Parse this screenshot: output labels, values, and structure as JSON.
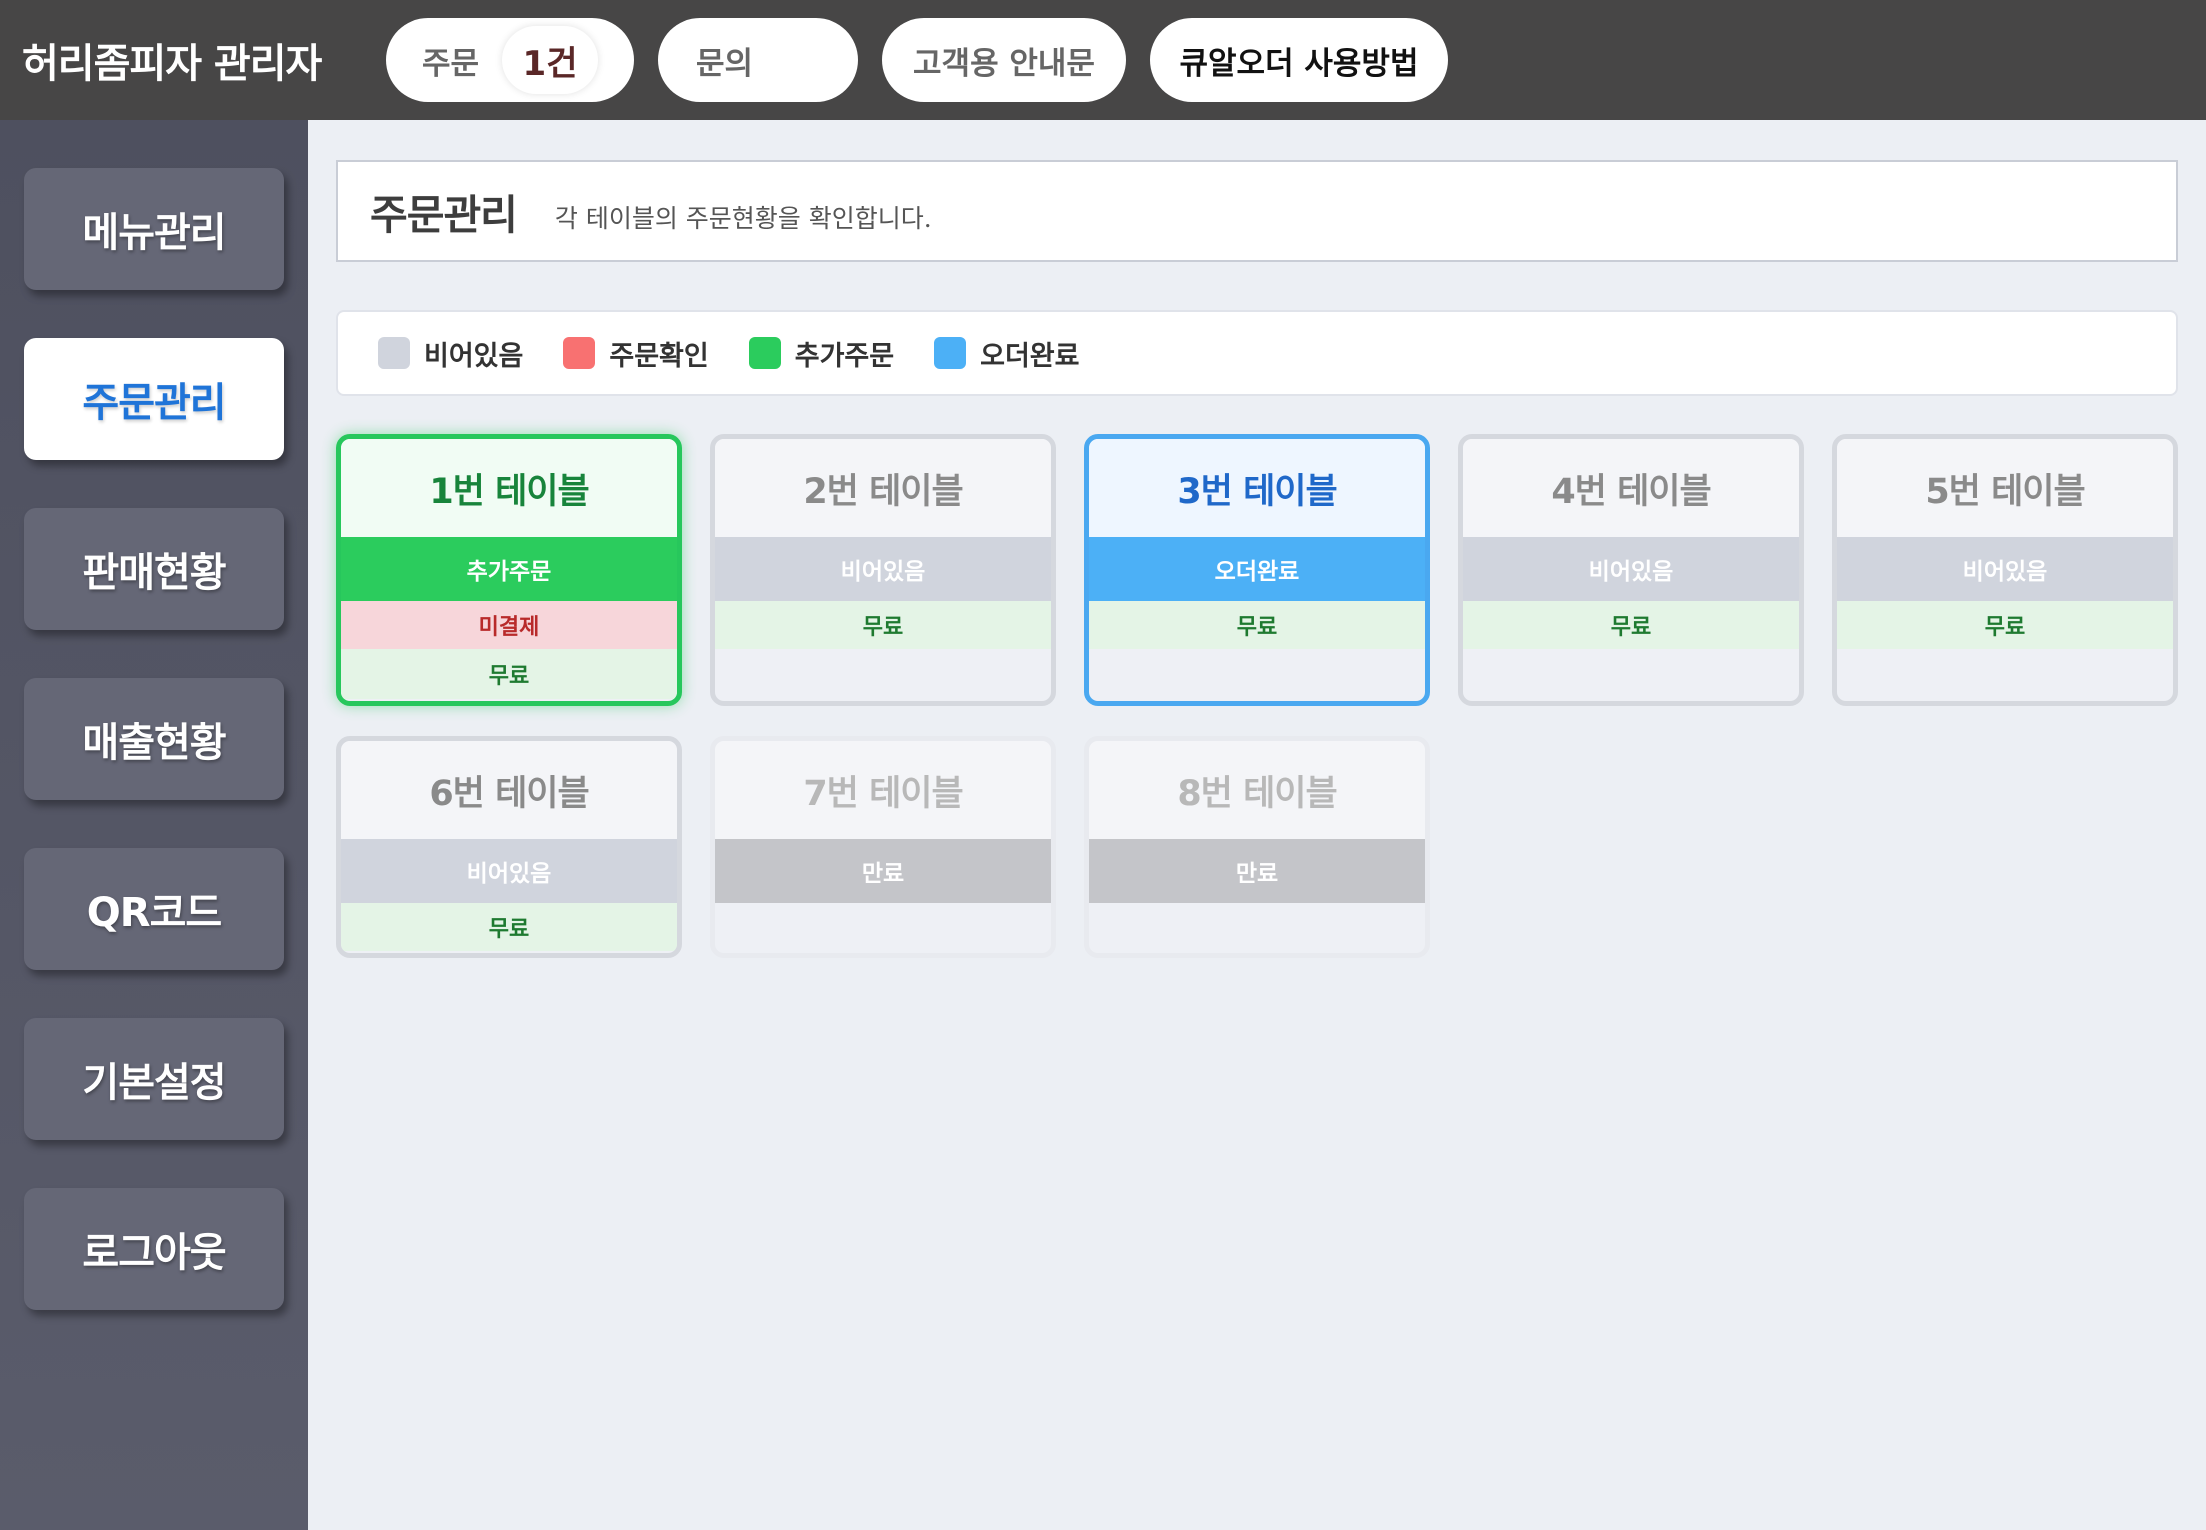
{
  "app_title": "허리좀피자 관리자",
  "topbar": {
    "orders_label": "주문",
    "orders_count": "1건",
    "inquiry_label": "문의",
    "guide_label": "고객용 안내문",
    "howto_label": "큐알오더 사용방법"
  },
  "sidebar": {
    "items": [
      {
        "label": "메뉴관리",
        "active": false
      },
      {
        "label": "주문관리",
        "active": true
      },
      {
        "label": "판매현황",
        "active": false
      },
      {
        "label": "매출현황",
        "active": false
      },
      {
        "label": "QR코드",
        "active": false
      },
      {
        "label": "기본설정",
        "active": false
      },
      {
        "label": "로그아웃",
        "active": false
      }
    ]
  },
  "header": {
    "title": "주문관리",
    "description": "각 테이블의 주문현황을 확인합니다."
  },
  "legend": [
    {
      "label": "비어있음",
      "color": "#d0d4dd"
    },
    {
      "label": "주문확인",
      "color": "#f87171"
    },
    {
      "label": "추가주문",
      "color": "#2bcc5d"
    },
    {
      "label": "오더완료",
      "color": "#4cb0f6"
    }
  ],
  "colors": {
    "topbar_bg": "#474646",
    "active_menu_text": "#1f74d8",
    "added_order": "#2bcc5d",
    "order_done": "#4cb0f6",
    "empty": "#d0d4dd"
  },
  "tables": [
    {
      "name": "1번 테이블",
      "status": "추가주문",
      "payment": "미결제",
      "plan": "무료",
      "state": "added"
    },
    {
      "name": "2번 테이블",
      "status": "비어있음",
      "payment": "",
      "plan": "무료",
      "state": "empty"
    },
    {
      "name": "3번 테이블",
      "status": "오더완료",
      "payment": "",
      "plan": "무료",
      "state": "done"
    },
    {
      "name": "4번 테이블",
      "status": "비어있음",
      "payment": "",
      "plan": "무료",
      "state": "empty"
    },
    {
      "name": "5번 테이블",
      "status": "비어있음",
      "payment": "",
      "plan": "무료",
      "state": "empty"
    },
    {
      "name": "6번 테이블",
      "status": "비어있음",
      "payment": "",
      "plan": "무료",
      "state": "empty"
    },
    {
      "name": "7번 테이블",
      "status": "만료",
      "payment": "",
      "plan": "",
      "state": "expired"
    },
    {
      "name": "8번 테이블",
      "status": "만료",
      "payment": "",
      "plan": "",
      "state": "expired"
    }
  ]
}
